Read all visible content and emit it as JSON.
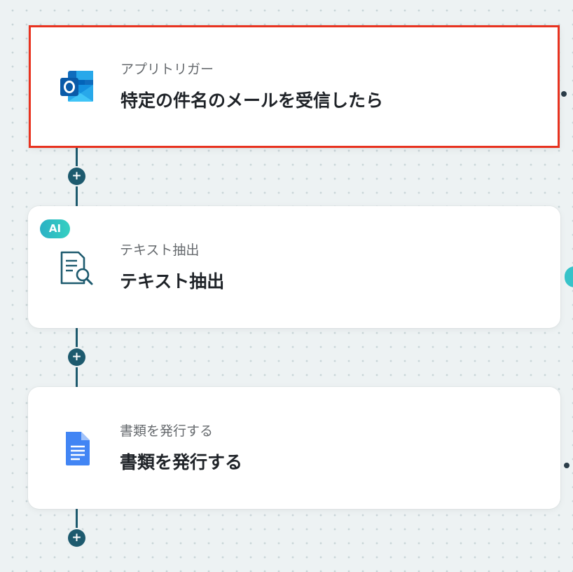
{
  "flow": {
    "steps": [
      {
        "subtitle": "アプリトリガー",
        "title": "特定の件名のメールを受信したら",
        "icon": "outlook-icon",
        "selected": true
      },
      {
        "badge": "AI",
        "subtitle": "テキスト抽出",
        "title": "テキスト抽出",
        "icon": "document-search-icon"
      },
      {
        "subtitle": "書類を発行する",
        "title": "書類を発行する",
        "icon": "google-docs-icon"
      }
    ],
    "add_step_symbol": "+"
  },
  "colors": {
    "selection_border": "#e8321f",
    "connector": "#1d5a6e",
    "ai_badge": "#2bb1c4",
    "outlook_blue": "#0f6cbd",
    "docs_blue": "#4285f4"
  }
}
